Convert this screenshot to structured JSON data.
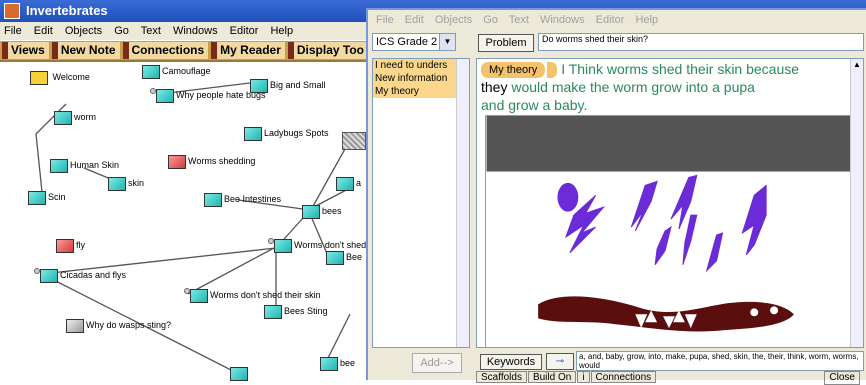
{
  "bg": {
    "title": "Invertebrates",
    "menu": [
      "File",
      "Edit",
      "Objects",
      "Go",
      "Text",
      "Windows",
      "Editor",
      "Help"
    ],
    "toolbar": [
      "Views",
      "New Note",
      "Connections",
      "My Reader",
      "Display Too"
    ],
    "notes": {
      "welcome": "Welcome",
      "camouflage": "Camouflage",
      "big_small": "Big and Small",
      "hate_bugs": "Why people hate bugs",
      "worm": "worm",
      "ladybugs": "Ladybugs Spots",
      "human_skin": "Human Skin",
      "skin": "skin",
      "worms_shedding": "Worms shedding",
      "scin": "Scin",
      "bee_intestines": "Bee Intestines",
      "bees": "bees",
      "a": "a",
      "worms_dont_shed": "Worms don't shed",
      "bee_short": "Bee",
      "fly": "fly",
      "cicadas": "Cicadas    and    flys",
      "worms_dont_shed_skin": "Worms don't shed their skin",
      "bees_sting": "Bees Sting",
      "wasps": "Why do wasps sting?",
      "bee": "bee"
    }
  },
  "fg": {
    "menu": [
      "File",
      "Edit",
      "Objects",
      "Go",
      "Text",
      "Windows",
      "Editor",
      "Help"
    ],
    "grade": "ICS Grade 2",
    "problem_label": "Problem",
    "problem_text": "Do worms shed their skin?",
    "scaffolds": [
      "I need to unders",
      "New information",
      "My theory"
    ],
    "add_label": "Add-->",
    "theory_tag": "My theory",
    "text_line1": "I Think worms shed their skin because",
    "text_line2a": "they",
    "text_line2b": " would make the worm grow into a pupa",
    "text_line3": "and grow a baby.",
    "keywords_label": "Keywords",
    "keywords_text": "a, and, baby, grow, into, make, pupa, shed, skin, the, their, think, worm, worms, would",
    "tabs": [
      "Scaffolds",
      "Build On",
      "i",
      "Connections"
    ],
    "close_label": "Close"
  }
}
